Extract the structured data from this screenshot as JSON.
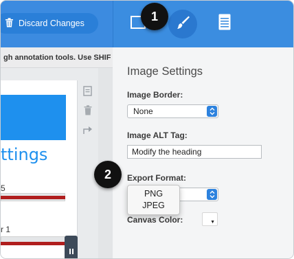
{
  "toolbar": {
    "discard_label": "Discard Changes"
  },
  "badges": [
    "1",
    "2"
  ],
  "instruction_text": "gh annotation tools. Use SHIF",
  "canvas": {
    "title": "ttings",
    "label_1": "5",
    "label_2": "r 1"
  },
  "settings": {
    "title": "Image Settings",
    "border_label": "Image Border:",
    "border_value": "None",
    "alt_label": "Image ALT Tag:",
    "alt_value": "Modify the heading",
    "export_label": "Export Format:",
    "export_options": [
      "PNG",
      "JPEG"
    ],
    "canvas_color_label": "Canvas Color:"
  },
  "colors": {
    "topbar": "#3b8de0",
    "accent": "#2d82de",
    "canvas_header": "#1e90ee",
    "canvas_line": "#b01e1e"
  },
  "icons": [
    "trash-icon",
    "image-icon",
    "brush-icon",
    "document-icon",
    "copy-icon",
    "delete-icon",
    "share-icon",
    "pause-icon",
    "chevron-updown-icon"
  ]
}
